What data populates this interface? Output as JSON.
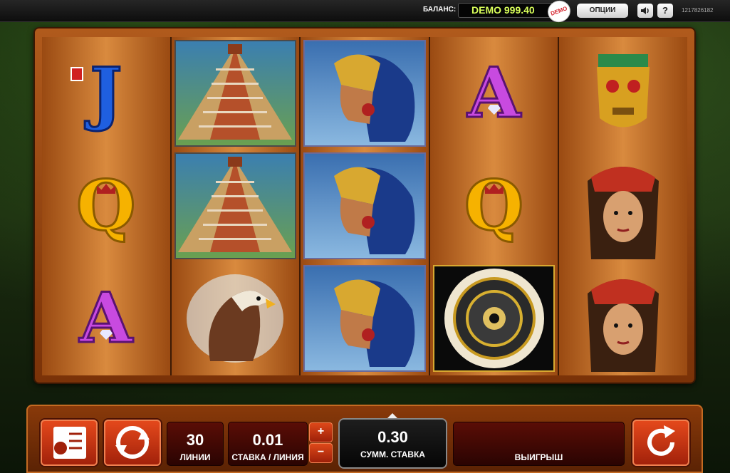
{
  "topbar": {
    "balance_label": "БАЛАНС:",
    "balance_value": "DEMO 999.40",
    "demo_badge": "DEMO",
    "options_label": "ОПЦИИ",
    "help_label": "?",
    "session_id": "1217826182"
  },
  "reels": [
    [
      "J",
      "pyramid",
      "Q"
    ],
    [
      "pyramid",
      "pyramid",
      "eagle"
    ],
    [
      "warrior",
      "warrior",
      "warrior"
    ],
    [
      "A",
      "Q",
      "calendar"
    ],
    [
      "mask",
      "princess",
      "princess"
    ]
  ],
  "reel_letters": {
    "r1c1": "J",
    "r1c2": "Q",
    "r1c3": "A",
    "r4c1": "A",
    "r4c2": "Q"
  },
  "controls": {
    "lines_value": "30",
    "lines_label": "ЛИНИИ",
    "bet_value": "0.01",
    "bet_label": "СТАВКА / ЛИНИЯ",
    "plus_label": "+",
    "minus_label": "−",
    "total_value": "0.30",
    "total_label": "СУММ. СТАВКА",
    "win_value": "",
    "win_label": "ВЫИГРЫШ"
  },
  "icons": [
    "paytable-icon",
    "autoplay-icon",
    "spin-icon",
    "sound-icon"
  ],
  "colors": {
    "accent": "#d98a3e",
    "balance_text": "#d9ff5a",
    "button": "#e64a1c"
  }
}
